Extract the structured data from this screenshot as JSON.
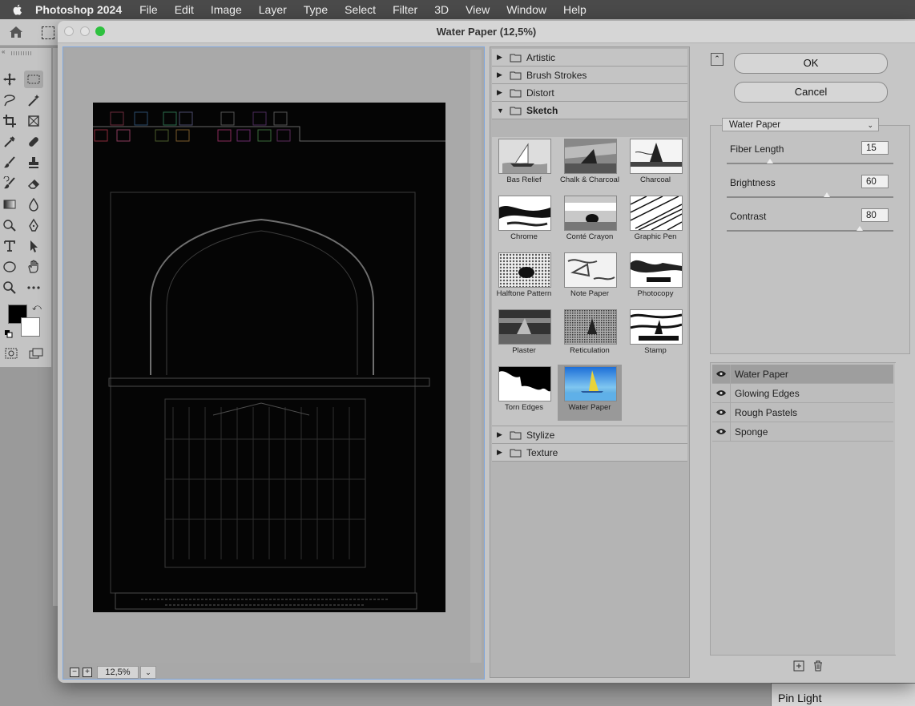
{
  "menubar": {
    "app_name": "Photoshop 2024",
    "items": [
      "File",
      "Edit",
      "Image",
      "Layer",
      "Type",
      "Select",
      "Filter",
      "3D",
      "View",
      "Window",
      "Help"
    ]
  },
  "dialog": {
    "title": "Water Paper (12,5%)",
    "zoom": "12,5%",
    "ok_label": "OK",
    "cancel_label": "Cancel"
  },
  "categories": {
    "artistic": "Artistic",
    "brush_strokes": "Brush Strokes",
    "distort": "Distort",
    "sketch": "Sketch",
    "stylize": "Stylize",
    "texture": "Texture"
  },
  "sketch_filters": [
    "Bas Relief",
    "Chalk & Charcoal",
    "Charcoal",
    "Chrome",
    "Conté Crayon",
    "Graphic Pen",
    "Halftone Pattern",
    "Note Paper",
    "Photocopy",
    "Plaster",
    "Reticulation",
    "Stamp",
    "Torn Edges",
    "Water Paper"
  ],
  "selected_filter": "Water Paper",
  "settings": {
    "filter_name": "Water Paper",
    "params": [
      {
        "label": "Fiber Length",
        "value": "15",
        "fraction": 0.26
      },
      {
        "label": "Brightness",
        "value": "60",
        "fraction": 0.6
      },
      {
        "label": "Contrast",
        "value": "80",
        "fraction": 0.8
      }
    ]
  },
  "effect_layers": [
    "Water Paper",
    "Glowing Edges",
    "Rough Pastels",
    "Sponge"
  ],
  "background": {
    "layers_panel_text": "Pin Light"
  }
}
